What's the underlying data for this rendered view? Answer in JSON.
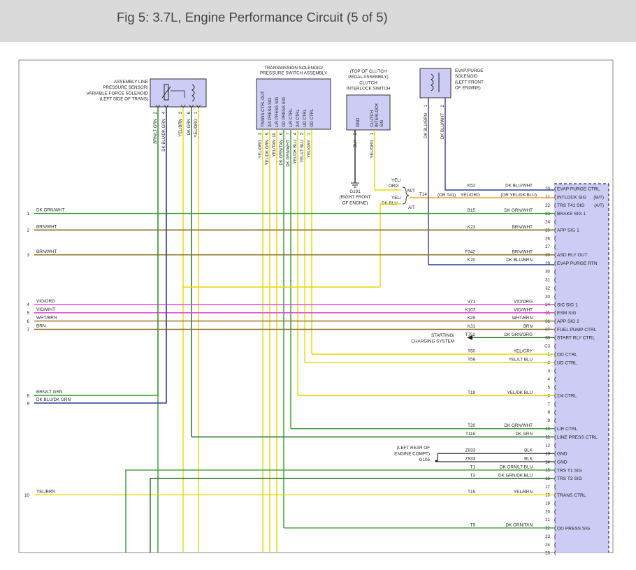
{
  "header": {
    "title": "Fig 5: 3.7L, Engine Performance Circuit (5 of 5)"
  },
  "colors": {
    "green": "#2f9e2f",
    "dkgreen": "#1f6b1f",
    "brown": "#8a6a1a",
    "yellow": "#e6d800",
    "magenta": "#e040d0",
    "blue": "#2a3d9c",
    "orange": "#f0a020",
    "black": "#000000",
    "pcm_fill": "#ccccf4",
    "header_bg": "#dadada"
  },
  "components": {
    "assembly_line": [
      "ASSEMBLY LINE",
      "PRESSURE SENSOR/",
      "VARIABLE FORCE SOLENOID",
      "(LEFT SIDE OF TRANS)"
    ],
    "trans_solenoid": {
      "title": [
        "TRANSMISSION SOLENOID/",
        "PRESSURE SWITCH ASSEMBLY"
      ],
      "pins": [
        "TRANS CTRL OUT",
        "2/4 PRESS SIG",
        "L/R PRESS SIG",
        "OD PRESS SIG",
        "L/R CTRL",
        "2/4 CTRL",
        "UD CTRL",
        "OD CTRL"
      ]
    },
    "clutch_switch": {
      "title": [
        "(TOP OF CLUTCH",
        "PEDAL ASSEMBLY)",
        "CLUTCH",
        "INTERLOCK SWITCH"
      ],
      "pins": [
        "GND",
        "CLUTCH INTERLOCK SIG"
      ]
    },
    "evap_solenoid": [
      "EVAP/PURGE",
      "SOLENOID",
      "(LEFT FRONT",
      "OF ENGINE)"
    ],
    "g101": [
      "G101",
      "(RIGHT FRONT",
      "OF ENGINE)"
    ],
    "g105": [
      "(LEFT REAR OF",
      "ENGINE COMPT)",
      "G105"
    ],
    "starting": [
      "STARTING/",
      "CHARGING SYSTEM"
    ]
  },
  "top_wire_labels": {
    "assembly": [
      {
        "pin": "2",
        "color": "BRN/LT GRN"
      },
      {
        "pin": "4",
        "color": "DK BLU/DK GRN"
      },
      {
        "pin": "3",
        "color": "YEL/BRN"
      },
      {
        "pin": "6",
        "color": "DK GRN"
      },
      {
        "pin": "1",
        "color": "YEL/ORG"
      }
    ],
    "trans": [
      {
        "pin": "3",
        "color": "YEL/ORG"
      },
      {
        "pin": "5",
        "color": "YEL/DK GRN"
      },
      {
        "pin": "10",
        "color": "YEL/TAN"
      },
      {
        "pin": "6",
        "color": "DK GRN/TAN"
      },
      {
        "pin": "7",
        "color": "DK GRN/WHT"
      },
      {
        "pin": "4",
        "color": "YEL/DK BLU"
      },
      {
        "pin": "2",
        "color": "YEL/LT BLU"
      },
      {
        "pin": "1",
        "color": "YEL/GRY"
      }
    ],
    "clutch": [
      {
        "pin": "3",
        "color": "BLK"
      },
      {
        "pin": "1",
        "color": "YEL/ORG"
      }
    ],
    "evap": [
      {
        "pin": "1",
        "color": "DK BLU/BRN"
      },
      {
        "pin": "2",
        "color": "DK BLU/WHT"
      }
    ]
  },
  "switch_labels": {
    "mt_color": "YEL/ ORG",
    "at_color": "YEL/ DK BLU",
    "mt": "M/T",
    "at": "A/T",
    "t14": "T14",
    "or_t41": "(OR T41)",
    "t14_color": "YEL/ORG",
    "or_dkbluwht": "(OR YEL/DK BLU)"
  },
  "pcm_pins": [
    {
      "n": "20",
      "label": "EVAP PURGE CTRL"
    },
    {
      "n": "21",
      "label": "INTLOCK SIG",
      "sub": "(M/T)"
    },
    {
      "n": "22",
      "label": "TRS T41 SIG",
      "sub": "(A/T)"
    },
    {
      "n": "23",
      "label": "BRAKE SIG 1"
    },
    {
      "n": "24",
      "label": ""
    },
    {
      "n": "25",
      "label": "APP SIG 1"
    },
    {
      "n": "26",
      "label": ""
    },
    {
      "n": "27",
      "label": ""
    },
    {
      "n": "28",
      "label": "ASD RLY OUT"
    },
    {
      "n": "29",
      "label": "EVAP PURGE RTN"
    },
    {
      "n": "30",
      "label": ""
    },
    {
      "n": "31",
      "label": ""
    },
    {
      "n": "32",
      "label": ""
    },
    {
      "n": "33",
      "label": ""
    },
    {
      "n": "34",
      "label": "S/C SIG 1"
    },
    {
      "n": "35",
      "label": "ESM SIG"
    },
    {
      "n": "36",
      "label": "APP SIG 2"
    },
    {
      "n": "37",
      "label": "FUEL PUMP CTRL"
    },
    {
      "n": "38",
      "label": "START RLY CTRL"
    },
    {
      "n": "C3",
      "label": ""
    },
    {
      "n": "1",
      "label": "OD CTRL"
    },
    {
      "n": "2",
      "label": "UD CTRL"
    },
    {
      "n": "3",
      "label": ""
    },
    {
      "n": "4",
      "label": ""
    },
    {
      "n": "5",
      "label": ""
    },
    {
      "n": "6",
      "label": "2/4 CTRL"
    },
    {
      "n": "7",
      "label": ""
    },
    {
      "n": "8",
      "label": ""
    },
    {
      "n": "9",
      "label": ""
    },
    {
      "n": "10",
      "label": "L/R CTRL"
    },
    {
      "n": "11",
      "label": "LINE PRESS CTRL"
    },
    {
      "n": "12",
      "label": ""
    },
    {
      "n": "13",
      "label": "GND"
    },
    {
      "n": "14",
      "label": "GND"
    },
    {
      "n": "15",
      "label": "TRS T1 SIG"
    },
    {
      "n": "16",
      "label": "TRS T3 SIG"
    },
    {
      "n": "17",
      "label": ""
    },
    {
      "n": "18",
      "label": "TRANS CTRL"
    },
    {
      "n": "19",
      "label": ""
    },
    {
      "n": "20",
      "label": ""
    },
    {
      "n": "21",
      "label": ""
    },
    {
      "n": "22",
      "label": "OD PRESS SIG"
    },
    {
      "n": "23",
      "label": ""
    },
    {
      "n": "24",
      "label": ""
    },
    {
      "n": "25",
      "label": ""
    }
  ],
  "circuits": [
    {
      "ckt": "K52",
      "color": "DK BLU/WHT"
    },
    {
      "ckt": "B15",
      "color": "DK GRN/WHT"
    },
    {
      "ckt": "K23",
      "color": "BRN/WHT"
    },
    {
      "ckt": "F342",
      "color": "BRN/WHT"
    },
    {
      "ckt": "K70",
      "color": "DK BLU/BRN"
    },
    {
      "ckt": "V71",
      "color": "VIO/ORG"
    },
    {
      "ckt": "K107",
      "color": "VIO/WHT"
    },
    {
      "ckt": "K29",
      "color": "WHT/BRN"
    },
    {
      "ckt": "K31",
      "color": "BRN"
    },
    {
      "ckt": "T752",
      "color": "DK GRN/ORG"
    },
    {
      "ckt": "T60",
      "color": "YEL/GRY"
    },
    {
      "ckt": "T59",
      "color": "YEL/LT BLU"
    },
    {
      "ckt": "T19",
      "color": "YEL/DK BLU"
    },
    {
      "ckt": "T20",
      "color": "DK GRN/WHT"
    },
    {
      "ckt": "T118",
      "color": "DK GRN"
    },
    {
      "ckt": "Z933",
      "color": "BLK"
    },
    {
      "ckt": "Z933",
      "color": "BLK"
    },
    {
      "ckt": "T1",
      "color": "DK GRN/LT BLU"
    },
    {
      "ckt": "T3",
      "color": "DK GRN/DK BLU"
    },
    {
      "ckt": "T15",
      "color": "YEL/BRN"
    },
    {
      "ckt": "T9",
      "color": "DK GRN/TAN"
    }
  ],
  "left_refs": [
    {
      "n": "1",
      "color": "DK GRN/WHT"
    },
    {
      "n": "2",
      "color": "BRN/WHT"
    },
    {
      "n": "3",
      "color": "BRN/WHT"
    },
    {
      "n": "4",
      "color": "VIO/ORG"
    },
    {
      "n": "5",
      "color": "VIO/WHT"
    },
    {
      "n": "6",
      "color": "WHT/BRN"
    },
    {
      "n": "7",
      "color": "BRN"
    },
    {
      "n": "8",
      "color": "BRN/LT GRN"
    },
    {
      "n": "9",
      "color": "DK BLU/DK GRN"
    },
    {
      "n": "10",
      "color": "YEL/BRN"
    }
  ]
}
